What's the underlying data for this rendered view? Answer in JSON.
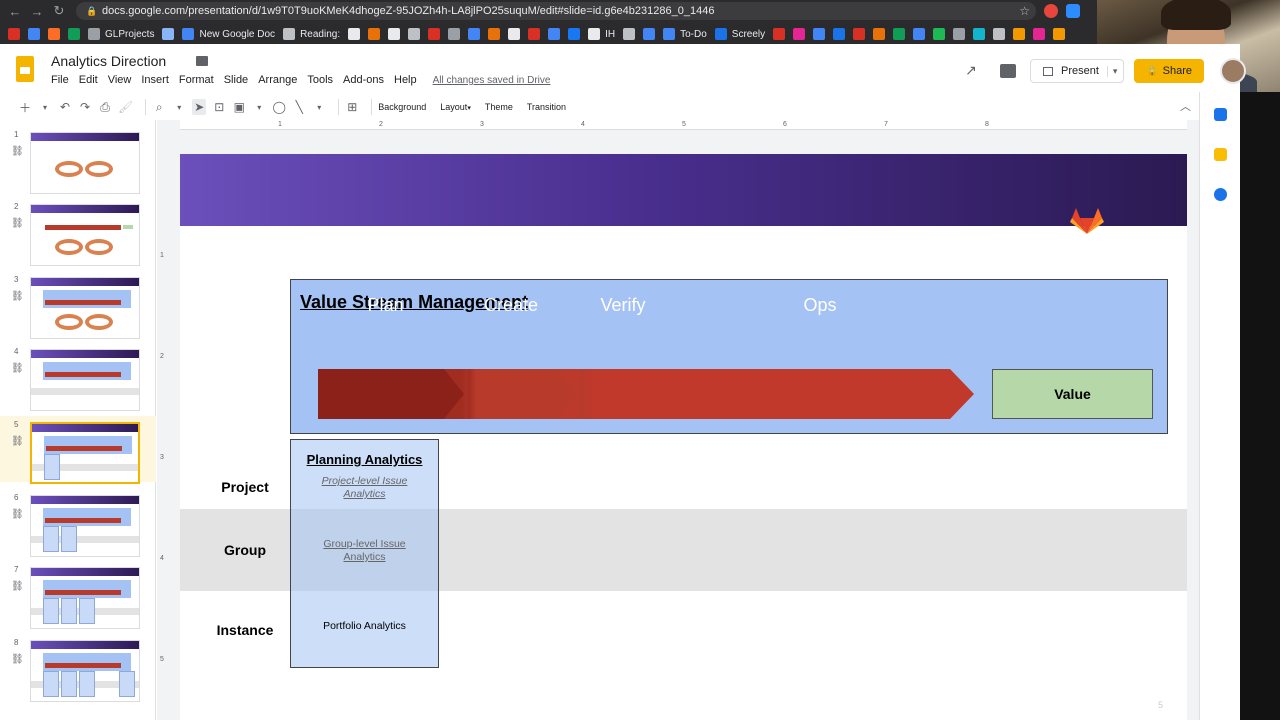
{
  "browser": {
    "url": "docs.google.com/presentation/d/1w9T0T9uoKMeK4dhogeZ-95JOZh4h-LA8jlPO25suquM/edit#slide=id.g6e4b231286_0_1446",
    "bookmarks": [
      {
        "label": "",
        "icon": "gmail-icon",
        "color": "#d93025"
      },
      {
        "label": "",
        "icon": "docs-blue-icon",
        "color": "#4285f4"
      },
      {
        "label": "",
        "icon": "gitlab-icon",
        "color": "#fc6d26"
      },
      {
        "label": "",
        "icon": "drive-icon",
        "color": "#0f9d58"
      },
      {
        "label": "GLProjects",
        "icon": "folder-icon",
        "color": "#9aa0a6"
      },
      {
        "label": "",
        "icon": "gear-bookmark-icon",
        "color": "#8ab4f8"
      },
      {
        "label": "New Google Doc",
        "icon": "google-doc-icon",
        "color": "#4285f4"
      },
      {
        "label": "Reading:",
        "icon": "reading-icon",
        "color": "#bdc1c6"
      },
      {
        "label": "",
        "icon": "circle-icon",
        "color": "#e8eaed"
      },
      {
        "label": "",
        "icon": "p-icon",
        "color": "#e8710a"
      },
      {
        "label": "",
        "icon": "medium-icon",
        "color": "#e8eaed"
      },
      {
        "label": "",
        "icon": "cloud-icon",
        "color": "#bdc1c6"
      },
      {
        "label": "",
        "icon": "red-dot-icon",
        "color": "#d93025"
      },
      {
        "label": "",
        "icon": "swirl-icon",
        "color": "#9aa0a6"
      },
      {
        "label": "",
        "icon": "blue-circle-icon",
        "color": "#4285f4"
      },
      {
        "label": "",
        "icon": "v-icon",
        "color": "#e8710a"
      },
      {
        "label": "",
        "icon": "hand-icon",
        "color": "#e8eaed"
      },
      {
        "label": "",
        "icon": "m-icon",
        "color": "#d93025"
      },
      {
        "label": "",
        "icon": "exclaim-icon",
        "color": "#4285f4"
      },
      {
        "label": "",
        "icon": "facebook-icon",
        "color": "#1877f2"
      },
      {
        "label": "IH",
        "icon": "ih-icon",
        "color": "#e8eaed"
      },
      {
        "label": "",
        "icon": "github-icon",
        "color": "#bdc1c6"
      },
      {
        "label": "",
        "icon": "doc-blue-icon-2",
        "color": "#4285f4"
      },
      {
        "label": "To-Do",
        "icon": "todo-icon",
        "color": "#4285f4"
      },
      {
        "label": "Screely",
        "icon": "screely-icon",
        "color": "#1a73e8"
      },
      {
        "label": "",
        "icon": "mail-icon",
        "color": "#d93025"
      },
      {
        "label": "",
        "icon": "k-icon",
        "color": "#e52592"
      },
      {
        "label": "",
        "icon": "calendar-icon",
        "color": "#4285f4"
      },
      {
        "label": "",
        "icon": "calendar-30-icon",
        "color": "#1a73e8"
      },
      {
        "label": "",
        "icon": "red-icon",
        "color": "#d93025"
      },
      {
        "label": "",
        "icon": "tools-icon",
        "color": "#e8710a"
      },
      {
        "label": "",
        "icon": "green-icon",
        "color": "#0f9d58"
      },
      {
        "label": "",
        "icon": "doc-icon-3",
        "color": "#4285f4"
      },
      {
        "label": "",
        "icon": "spotify-icon",
        "color": "#1db954"
      },
      {
        "label": "",
        "icon": "grey-icon",
        "color": "#9aa0a6"
      },
      {
        "label": "",
        "icon": "teal-icon",
        "color": "#12b5cb"
      },
      {
        "label": "",
        "icon": "wave-icon",
        "color": "#bdc1c6"
      },
      {
        "label": "",
        "icon": "orange-icon",
        "color": "#f29900"
      },
      {
        "label": "",
        "icon": "h-icon",
        "color": "#e52592"
      },
      {
        "label": "",
        "icon": "play-icon",
        "color": "#f29900"
      }
    ]
  },
  "docs": {
    "title": "Analytics Direction",
    "menus": [
      "File",
      "Edit",
      "View",
      "Insert",
      "Format",
      "Slide",
      "Arrange",
      "Tools",
      "Add-ons",
      "Help"
    ],
    "saved_status": "All changes saved in Drive",
    "present_label": "Present",
    "share_label": "Share"
  },
  "toolbar": {
    "background_label": "Background",
    "layout_label": "Layout",
    "theme_label": "Theme",
    "transition_label": "Transition"
  },
  "ruler": {
    "h": [
      "1",
      "2",
      "3",
      "4",
      "5",
      "6",
      "7",
      "8"
    ],
    "v": [
      "1",
      "2",
      "3",
      "4",
      "5"
    ]
  },
  "filmstrip": {
    "numbers": [
      "1",
      "2",
      "3",
      "4",
      "5",
      "6",
      "7",
      "8"
    ],
    "selected": "5"
  },
  "slide": {
    "vsm_title": "Value Stream Management",
    "stages": [
      "Plan",
      "Create",
      "Verify",
      "Ops"
    ],
    "value_label": "Value",
    "row_labels": [
      "Project",
      "Group",
      "Instance"
    ],
    "planning_title": "Planning Analytics",
    "project_cell": "Project-level Issue Analytics",
    "group_cell": "Group-level Issue Analytics",
    "instance_cell": "Portfolio Analytics",
    "page_number": "5",
    "colors": {
      "banner_start": "#6b4fbb",
      "banner_end": "#2b1a52",
      "vsm_fill": "#a4c2f4",
      "arrow_dark": "#8b2118",
      "arrow_mid": "#b73a2a",
      "arrow_light": "#c0392b",
      "value_fill": "#b6d7a8",
      "group_band": "#e3e3e3"
    }
  }
}
